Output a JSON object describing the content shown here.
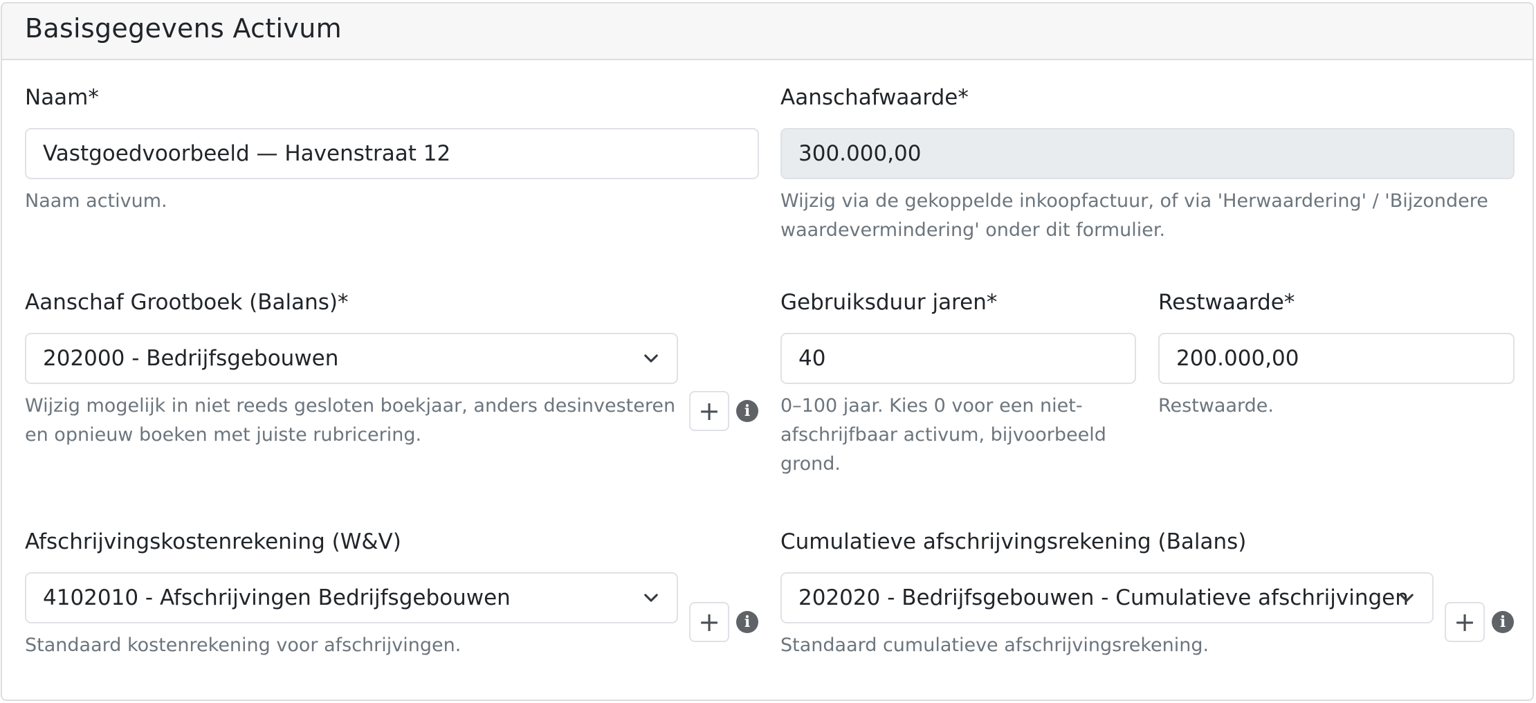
{
  "card": {
    "title": "Basisgegevens Activum"
  },
  "fields": {
    "naam": {
      "label": "Naam*",
      "value": "Vastgoedvoorbeeld — Havenstraat 12",
      "help": "Naam activum."
    },
    "aanschafwaarde": {
      "label": "Aanschafwaarde*",
      "value": "300.000,00",
      "help": "Wijzig via de gekoppelde inkoopfactuur, of via 'Herwaardering' / 'Bijzondere waardevermindering' onder dit formulier."
    },
    "aanschaf_grootboek": {
      "label": "Aanschaf Grootboek (Balans)*",
      "value": "202000 - Bedrijfsgebouwen",
      "help": "Wijzig mogelijk in niet reeds gesloten boekjaar, anders desinvesteren en opnieuw boeken met juiste rubricering."
    },
    "gebruiksduur": {
      "label": "Gebruiksduur jaren*",
      "value": "40",
      "help": "0–100 jaar. Kies 0 voor een niet-afschrijfbaar activum, bijvoorbeeld grond."
    },
    "restwaarde": {
      "label": "Restwaarde*",
      "value": "200.000,00",
      "help": "Restwaarde."
    },
    "afschrijvingskosten": {
      "label": "Afschrijvingskostenrekening (W&V)",
      "value": "4102010 - Afschrijvingen Bedrijfsgebouwen",
      "help": "Standaard kostenrekening voor afschrijvingen."
    },
    "cumulatieve_afschrijving": {
      "label": "Cumulatieve afschrijvingsrekening (Balans)",
      "value": "202020 - Bedrijfsgebouwen - Cumulatieve afschrijvingen",
      "help": "Standaard cumulatieve afschrijvingsrekening."
    }
  },
  "buttons": {
    "add_symbol": "+",
    "info_symbol": "i"
  },
  "icons": {
    "select_arrow": "chevron-down-icon",
    "add": "plus-icon",
    "info": "info-icon"
  },
  "colors": {
    "border": "#dee2e6",
    "header_bg": "#f7f7f7",
    "readonly_bg": "#e9ecef",
    "muted_text": "#6c757d",
    "info_bg": "#5f6368"
  }
}
